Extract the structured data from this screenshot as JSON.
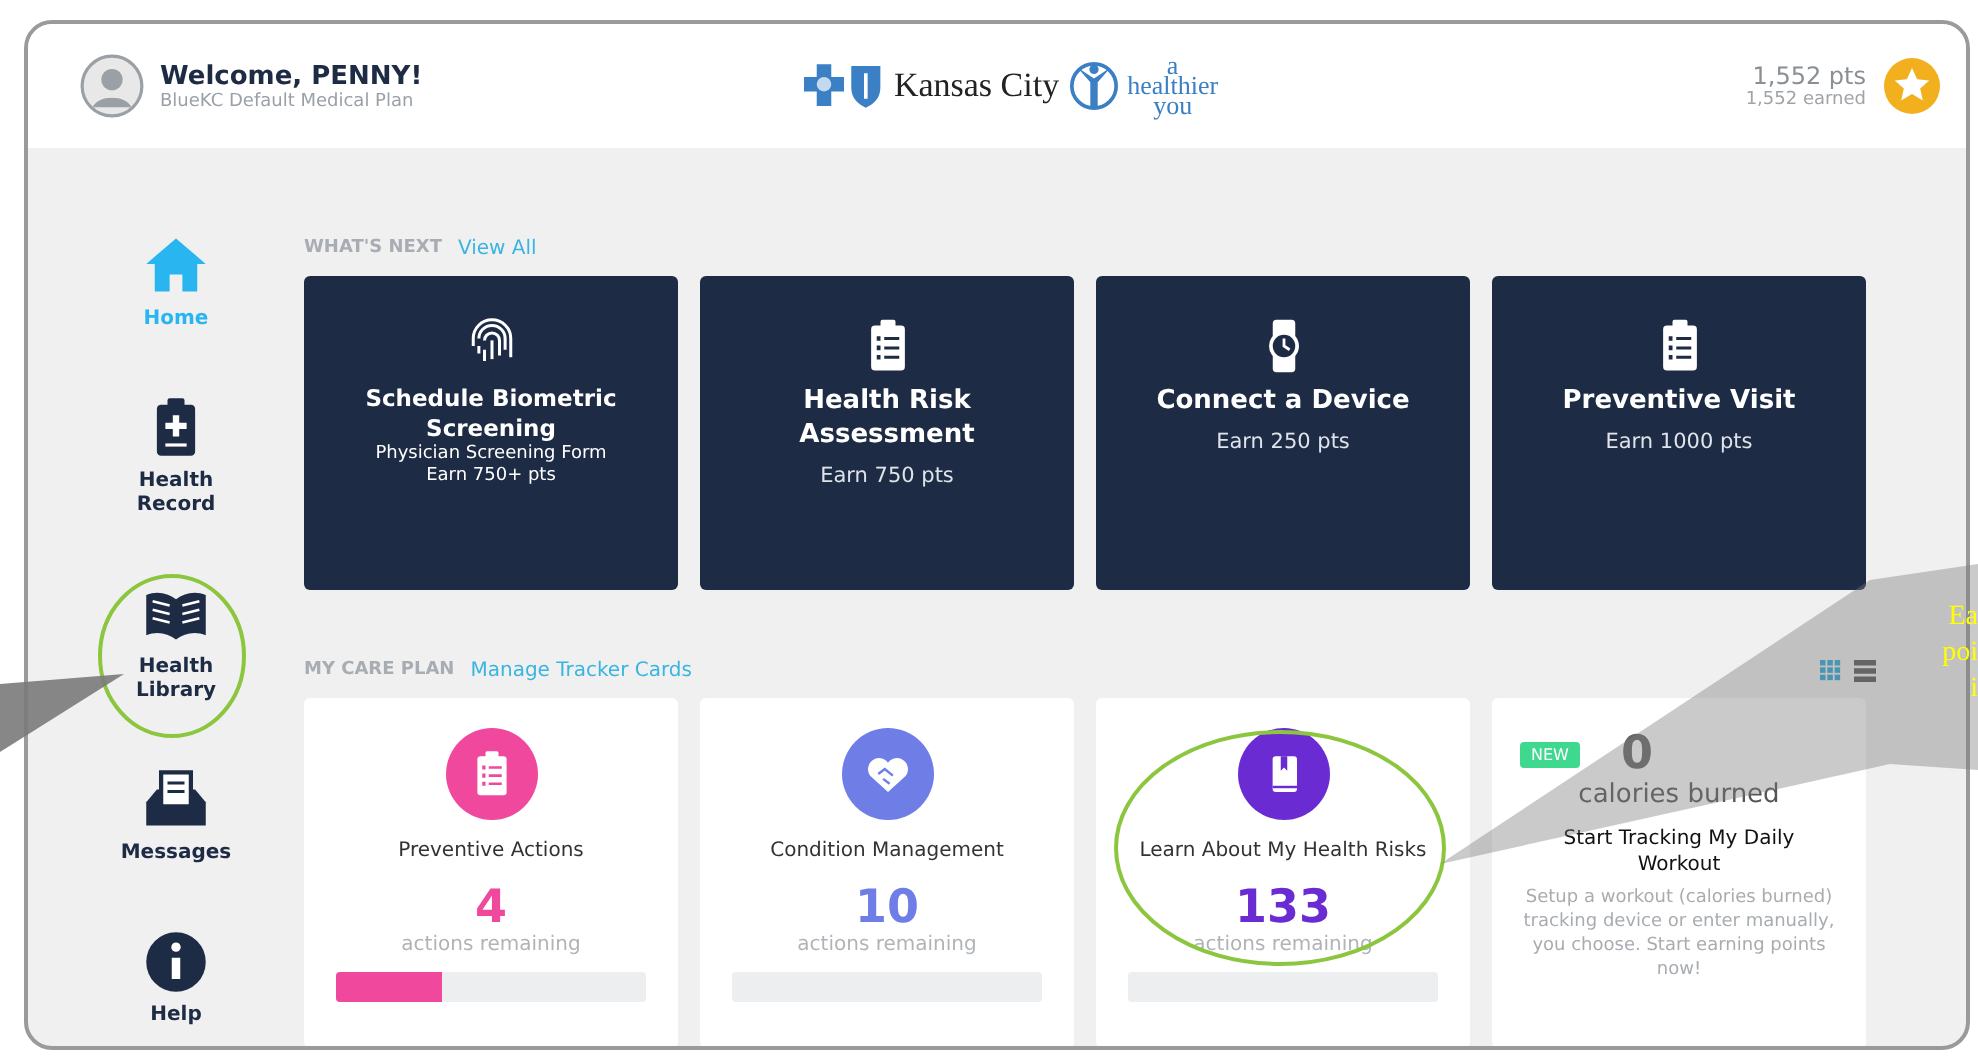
{
  "header": {
    "welcome": "Welcome, PENNY!",
    "plan": "BlueKC Default Medical Plan",
    "brand": "Kansas City",
    "tagline_top": "a",
    "tagline_mid": "healthier",
    "tagline_bottom": "you",
    "points": "1,552 pts",
    "earned": "1,552 earned"
  },
  "nav": [
    {
      "label": "Home",
      "selected": true
    },
    {
      "label": "Health Record",
      "selected": false
    },
    {
      "label": "Health Library",
      "selected": false
    },
    {
      "label": "Messages",
      "selected": false
    },
    {
      "label": "Help",
      "selected": false
    }
  ],
  "whats_next": {
    "heading": "WHAT'S NEXT",
    "link": "View All",
    "cards": [
      {
        "title": "Schedule Biometric Screening",
        "subtitle": "Physician Screening Form",
        "reward": "Earn 750+ pts"
      },
      {
        "title": "Health Risk Assessment",
        "reward": "Earn 750 pts"
      },
      {
        "title": "Connect a Device",
        "reward": "Earn 250 pts"
      },
      {
        "title": "Preventive Visit",
        "reward": "Earn 1000 pts"
      }
    ]
  },
  "care_plan": {
    "heading": "MY CARE PLAN",
    "link": "Manage Tracker Cards",
    "cards": [
      {
        "kind": "action",
        "color": "#f0489c",
        "title": "Preventive Actions",
        "count": "4",
        "caption": "actions remaining",
        "level": 0.34
      },
      {
        "kind": "action",
        "color": "#6f7de6",
        "title": "Condition Management",
        "count": "10",
        "caption": "actions remaining",
        "level": 0
      },
      {
        "kind": "action",
        "color": "#6a2bd3",
        "title": "Learn About My Health Risks",
        "count": "133",
        "caption": "actions remaining",
        "level": 0
      },
      {
        "kind": "tracker",
        "badge": "NEW",
        "count": "0",
        "caption": "calories burned",
        "title": "Start Tracking My Daily Workout",
        "description": "Setup a workout (calories burned) tracking device or enter manually, you choose. Start earning points now!"
      }
    ]
  },
  "annotation": {
    "callout_lines": [
      "Ea",
      "poi",
      "i"
    ]
  }
}
